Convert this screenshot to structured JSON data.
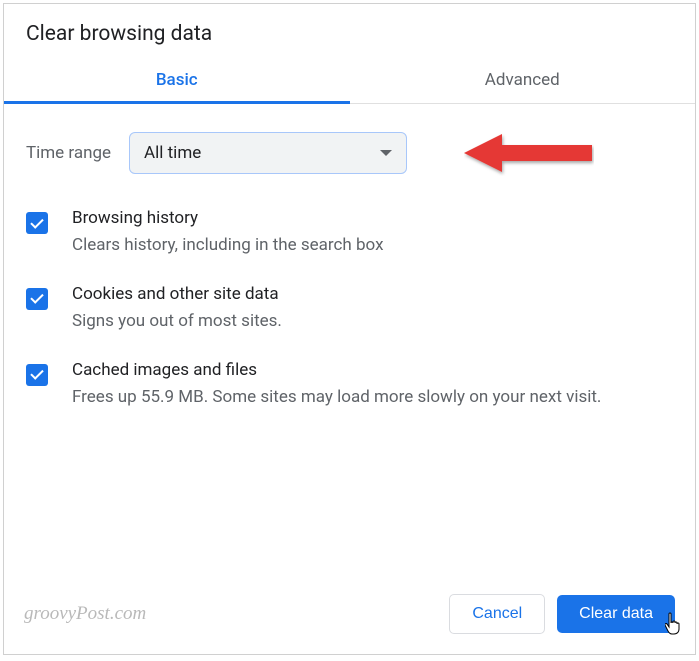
{
  "dialog": {
    "title": "Clear browsing data",
    "tabs": {
      "basic": "Basic",
      "advanced": "Advanced"
    },
    "timeRange": {
      "label": "Time range",
      "value": "All time"
    },
    "options": [
      {
        "title": "Browsing history",
        "desc": "Clears history, including in the search box"
      },
      {
        "title": "Cookies and other site data",
        "desc": "Signs you out of most sites."
      },
      {
        "title": "Cached images and files",
        "desc": "Frees up 55.9 MB. Some sites may load more slowly on your next visit."
      }
    ],
    "buttons": {
      "cancel": "Cancel",
      "confirm": "Clear data"
    }
  },
  "watermark": "groovyPost.com"
}
